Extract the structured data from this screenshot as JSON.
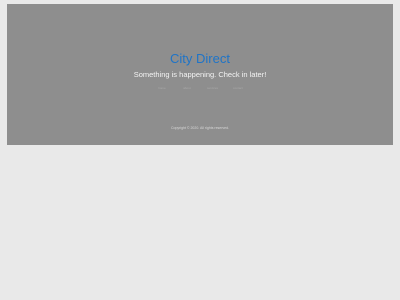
{
  "hero": {
    "title": "City Direct",
    "subtitle": "Something is happening. Check in later!",
    "nav": [
      "home",
      "about",
      "services",
      "contact"
    ],
    "copyright": "Copyright © 2020. All rights reserved."
  },
  "colors": {
    "page_background": "#e9e9e9",
    "hero_background": "#8e8e8e",
    "title_color": "#1f74c7"
  }
}
